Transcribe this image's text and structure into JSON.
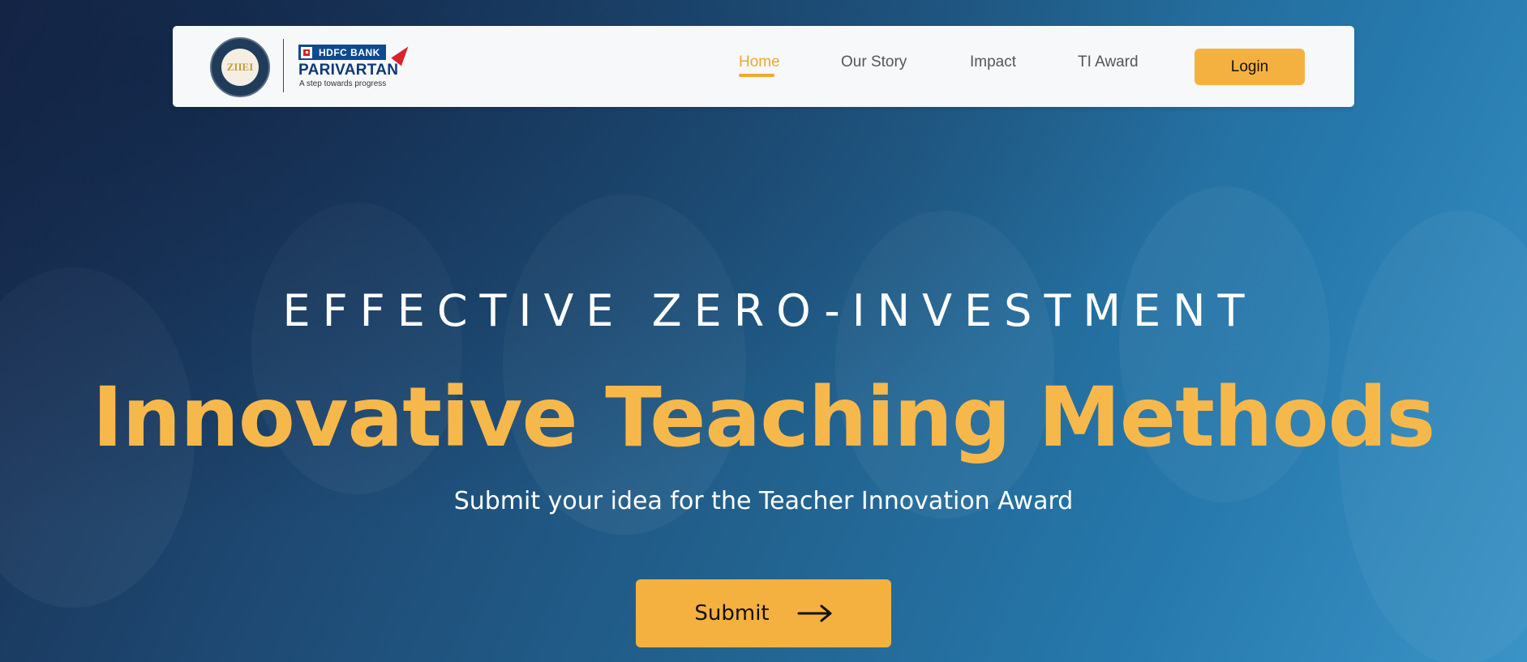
{
  "brand": {
    "seal_text": "ZIIEI",
    "bank_badge": "HDFC BANK",
    "program_name": "PARIVARTAN",
    "tagline": "A step towards progress"
  },
  "nav": {
    "links": [
      {
        "label": "Home",
        "active": true
      },
      {
        "label": "Our Story",
        "active": false
      },
      {
        "label": "Impact",
        "active": false
      },
      {
        "label": "TI Award",
        "active": false
      }
    ],
    "login_label": "Login"
  },
  "hero": {
    "eyebrow": "EFFECTIVE ZERO-INVESTMENT",
    "title": "Innovative Teaching Methods",
    "subtitle": "Submit your idea for the Teacher Innovation Award",
    "submit_label": "Submit"
  },
  "colors": {
    "accent": "#f5b13f",
    "title": "#f7b84b",
    "bank_blue": "#0d4a8f",
    "bank_red": "#d8232a"
  },
  "icons": {
    "submit_icon": "arrow-right-icon",
    "brand_mark": "red-arrow-icon",
    "bank_logo": "hdfc-square-icon"
  }
}
